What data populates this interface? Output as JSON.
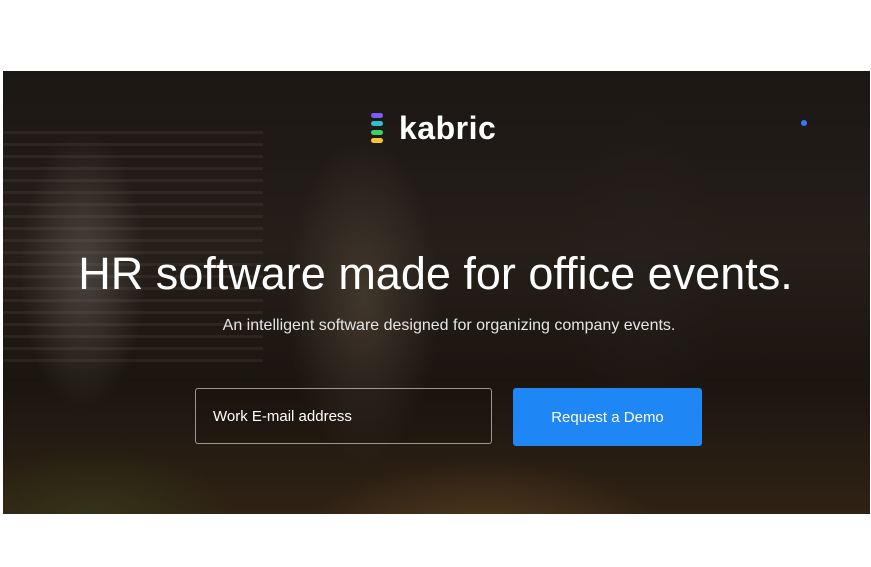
{
  "brand": {
    "name": "kabric",
    "mark_colors": [
      "#7b5cf5",
      "#2fc1c9",
      "#3fcf6a",
      "#f7c531"
    ]
  },
  "hero": {
    "headline": "HR software made for office events.",
    "subheadline": "An intelligent software designed for organizing company events."
  },
  "form": {
    "email_placeholder": "Work E-mail address",
    "cta_label": "Request a Demo"
  },
  "colors": {
    "accent": "#1f86f5",
    "dot": "#2f7bff"
  }
}
